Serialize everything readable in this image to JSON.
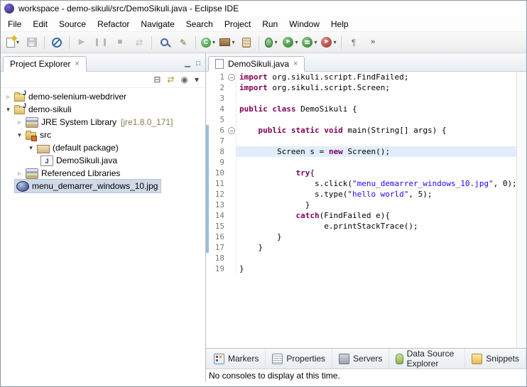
{
  "window": {
    "title": "workspace - demo-sikuli/src/DemoSikuli.java - Eclipse IDE"
  },
  "menu": {
    "items": [
      "File",
      "Edit",
      "Source",
      "Refactor",
      "Navigate",
      "Search",
      "Project",
      "Run",
      "Window",
      "Help"
    ]
  },
  "toolbar": {
    "buttons": [
      {
        "name": "new",
        "icon": "new",
        "dropdown": true
      },
      {
        "name": "save",
        "icon": "save",
        "disabled": true
      },
      {
        "sep": true
      },
      {
        "name": "skip-all-breakpoints",
        "icon": "skip"
      },
      {
        "sep": true
      },
      {
        "name": "resume",
        "icon": "resume",
        "glyph": "▶",
        "disabled": true
      },
      {
        "name": "suspend",
        "icon": "suspend",
        "disabled": true
      },
      {
        "name": "terminate",
        "icon": "terminate",
        "glyph": "■",
        "disabled": true
      },
      {
        "name": "disconnect",
        "icon": "disconnect",
        "glyph": "⇄",
        "disabled": true
      },
      {
        "sep": true
      },
      {
        "name": "search",
        "icon": "search"
      },
      {
        "name": "open-task",
        "icon": "task",
        "glyph": "✎"
      },
      {
        "sep": true
      },
      {
        "name": "new-java-class",
        "icon": "class",
        "glyph": "C",
        "dropdown": true
      },
      {
        "name": "new-java-package",
        "icon": "pkg",
        "dropdown": true
      },
      {
        "name": "open-type",
        "icon": "jar"
      },
      {
        "sep": true
      },
      {
        "name": "debug",
        "icon": "bug",
        "dropdown": true
      },
      {
        "name": "run",
        "icon": "run",
        "dropdown": true
      },
      {
        "name": "coverage",
        "icon": "coverage",
        "dropdown": true
      },
      {
        "name": "profile",
        "icon": "profile",
        "dropdown": true
      },
      {
        "sep": true
      },
      {
        "name": "mark-occurrences",
        "icon": "marker",
        "glyph": "¶"
      },
      {
        "name": "toolbar-overflow",
        "icon": "chevron",
        "glyph": "»"
      }
    ]
  },
  "explorer": {
    "title": "Project Explorer",
    "controls": {
      "minimize": "▁",
      "maximize": "□"
    },
    "toolbar": [
      {
        "name": "collapse-all",
        "glyph": "⊟",
        "color": "#555"
      },
      {
        "name": "link-with-editor",
        "glyph": "⇄",
        "color": "#b8912a"
      },
      {
        "name": "focus-active-task",
        "glyph": "◉",
        "color": "#666"
      },
      {
        "name": "view-menu",
        "glyph": "▾",
        "color": "#444"
      }
    ],
    "tree": [
      {
        "level": 0,
        "expand": "collapsed",
        "icon": "project",
        "label": "demo-selenium-webdriver"
      },
      {
        "level": 0,
        "expand": "expanded",
        "icon": "project",
        "label": "demo-sikuli"
      },
      {
        "level": 1,
        "expand": "collapsed",
        "icon": "jre",
        "label": "JRE System Library",
        "suffix": "[jre1.8.0_171]"
      },
      {
        "level": 1,
        "expand": "expanded",
        "icon": "src",
        "label": "src"
      },
      {
        "level": 2,
        "expand": "expanded",
        "icon": "pkgdef",
        "label": "(default package)"
      },
      {
        "level": 3,
        "expand": "none",
        "icon": "jfile",
        "label": "DemoSikuli.java"
      },
      {
        "level": 1,
        "expand": "collapsed",
        "icon": "reflib",
        "label": "Referenced Libraries"
      },
      {
        "level": 1,
        "expand": "none",
        "icon": "image",
        "label": "menu_demarrer_windows_10.jpg",
        "selected": true
      }
    ]
  },
  "editor": {
    "tab": "DemoSikuli.java",
    "current_line": 8,
    "fold_lines": [
      1,
      6
    ],
    "range_start": 6,
    "range_end": 17,
    "code": [
      {
        "n": 1,
        "t": [
          [
            "k",
            "import"
          ],
          [
            "p",
            " org.sikuli.script.FindFailed;"
          ]
        ]
      },
      {
        "n": 2,
        "t": [
          [
            "k",
            "import"
          ],
          [
            "p",
            " org.sikuli.script.Screen;"
          ]
        ]
      },
      {
        "n": 3,
        "t": []
      },
      {
        "n": 4,
        "t": [
          [
            "k",
            "public"
          ],
          [
            "p",
            " "
          ],
          [
            "k",
            "class"
          ],
          [
            "p",
            " DemoSikuli {"
          ]
        ]
      },
      {
        "n": 5,
        "t": []
      },
      {
        "n": 6,
        "t": [
          [
            "p",
            "    "
          ],
          [
            "k",
            "public"
          ],
          [
            "p",
            " "
          ],
          [
            "k",
            "static"
          ],
          [
            "p",
            " "
          ],
          [
            "k",
            "void"
          ],
          [
            "p",
            " main(String[] args) {"
          ]
        ]
      },
      {
        "n": 7,
        "t": []
      },
      {
        "n": 8,
        "t": [
          [
            "p",
            "        Screen s = "
          ],
          [
            "k",
            "new"
          ],
          [
            "p",
            " Screen();"
          ]
        ]
      },
      {
        "n": 9,
        "t": []
      },
      {
        "n": 10,
        "t": [
          [
            "p",
            "            "
          ],
          [
            "k",
            "try"
          ],
          [
            "p",
            "{"
          ]
        ]
      },
      {
        "n": 11,
        "t": [
          [
            "p",
            "                s.click("
          ],
          [
            "s",
            "\"menu_demarrer_windows_10.jpg\""
          ],
          [
            "p",
            ", 0);"
          ]
        ]
      },
      {
        "n": 12,
        "t": [
          [
            "p",
            "                s.type("
          ],
          [
            "s",
            "\"hello world\""
          ],
          [
            "p",
            ", 5);"
          ]
        ]
      },
      {
        "n": 13,
        "t": [
          [
            "p",
            "              }"
          ]
        ]
      },
      {
        "n": 14,
        "t": [
          [
            "p",
            "            "
          ],
          [
            "k",
            "catch"
          ],
          [
            "p",
            "(FindFailed e){"
          ]
        ]
      },
      {
        "n": 15,
        "t": [
          [
            "p",
            "                  e.printStackTrace();"
          ]
        ]
      },
      {
        "n": 16,
        "t": [
          [
            "p",
            "        }"
          ]
        ]
      },
      {
        "n": 17,
        "t": [
          [
            "p",
            "    }"
          ]
        ]
      },
      {
        "n": 18,
        "t": []
      },
      {
        "n": 19,
        "t": [
          [
            "p",
            "}"
          ]
        ]
      }
    ]
  },
  "bottom": {
    "tabs": [
      {
        "name": "markers",
        "label": "Markers",
        "icon": "markers"
      },
      {
        "name": "properties",
        "label": "Properties",
        "icon": "properties"
      },
      {
        "name": "servers",
        "label": "Servers",
        "icon": "servers"
      },
      {
        "name": "data-source-explorer",
        "label": "Data Source Explorer",
        "icon": "dse"
      },
      {
        "name": "snippets",
        "label": "Snippets",
        "icon": "snippets"
      }
    ],
    "message": "No consoles to display at this time."
  },
  "icons": {
    "close": "×",
    "twistie_collapsed": "▹",
    "twistie_expanded": "▾"
  },
  "colors": {
    "keyword": "#7f0055",
    "string": "#2a00ff",
    "current_line": "#e2edfb",
    "range_bar": "#9dbdd9",
    "selection": "#cfdae6"
  }
}
